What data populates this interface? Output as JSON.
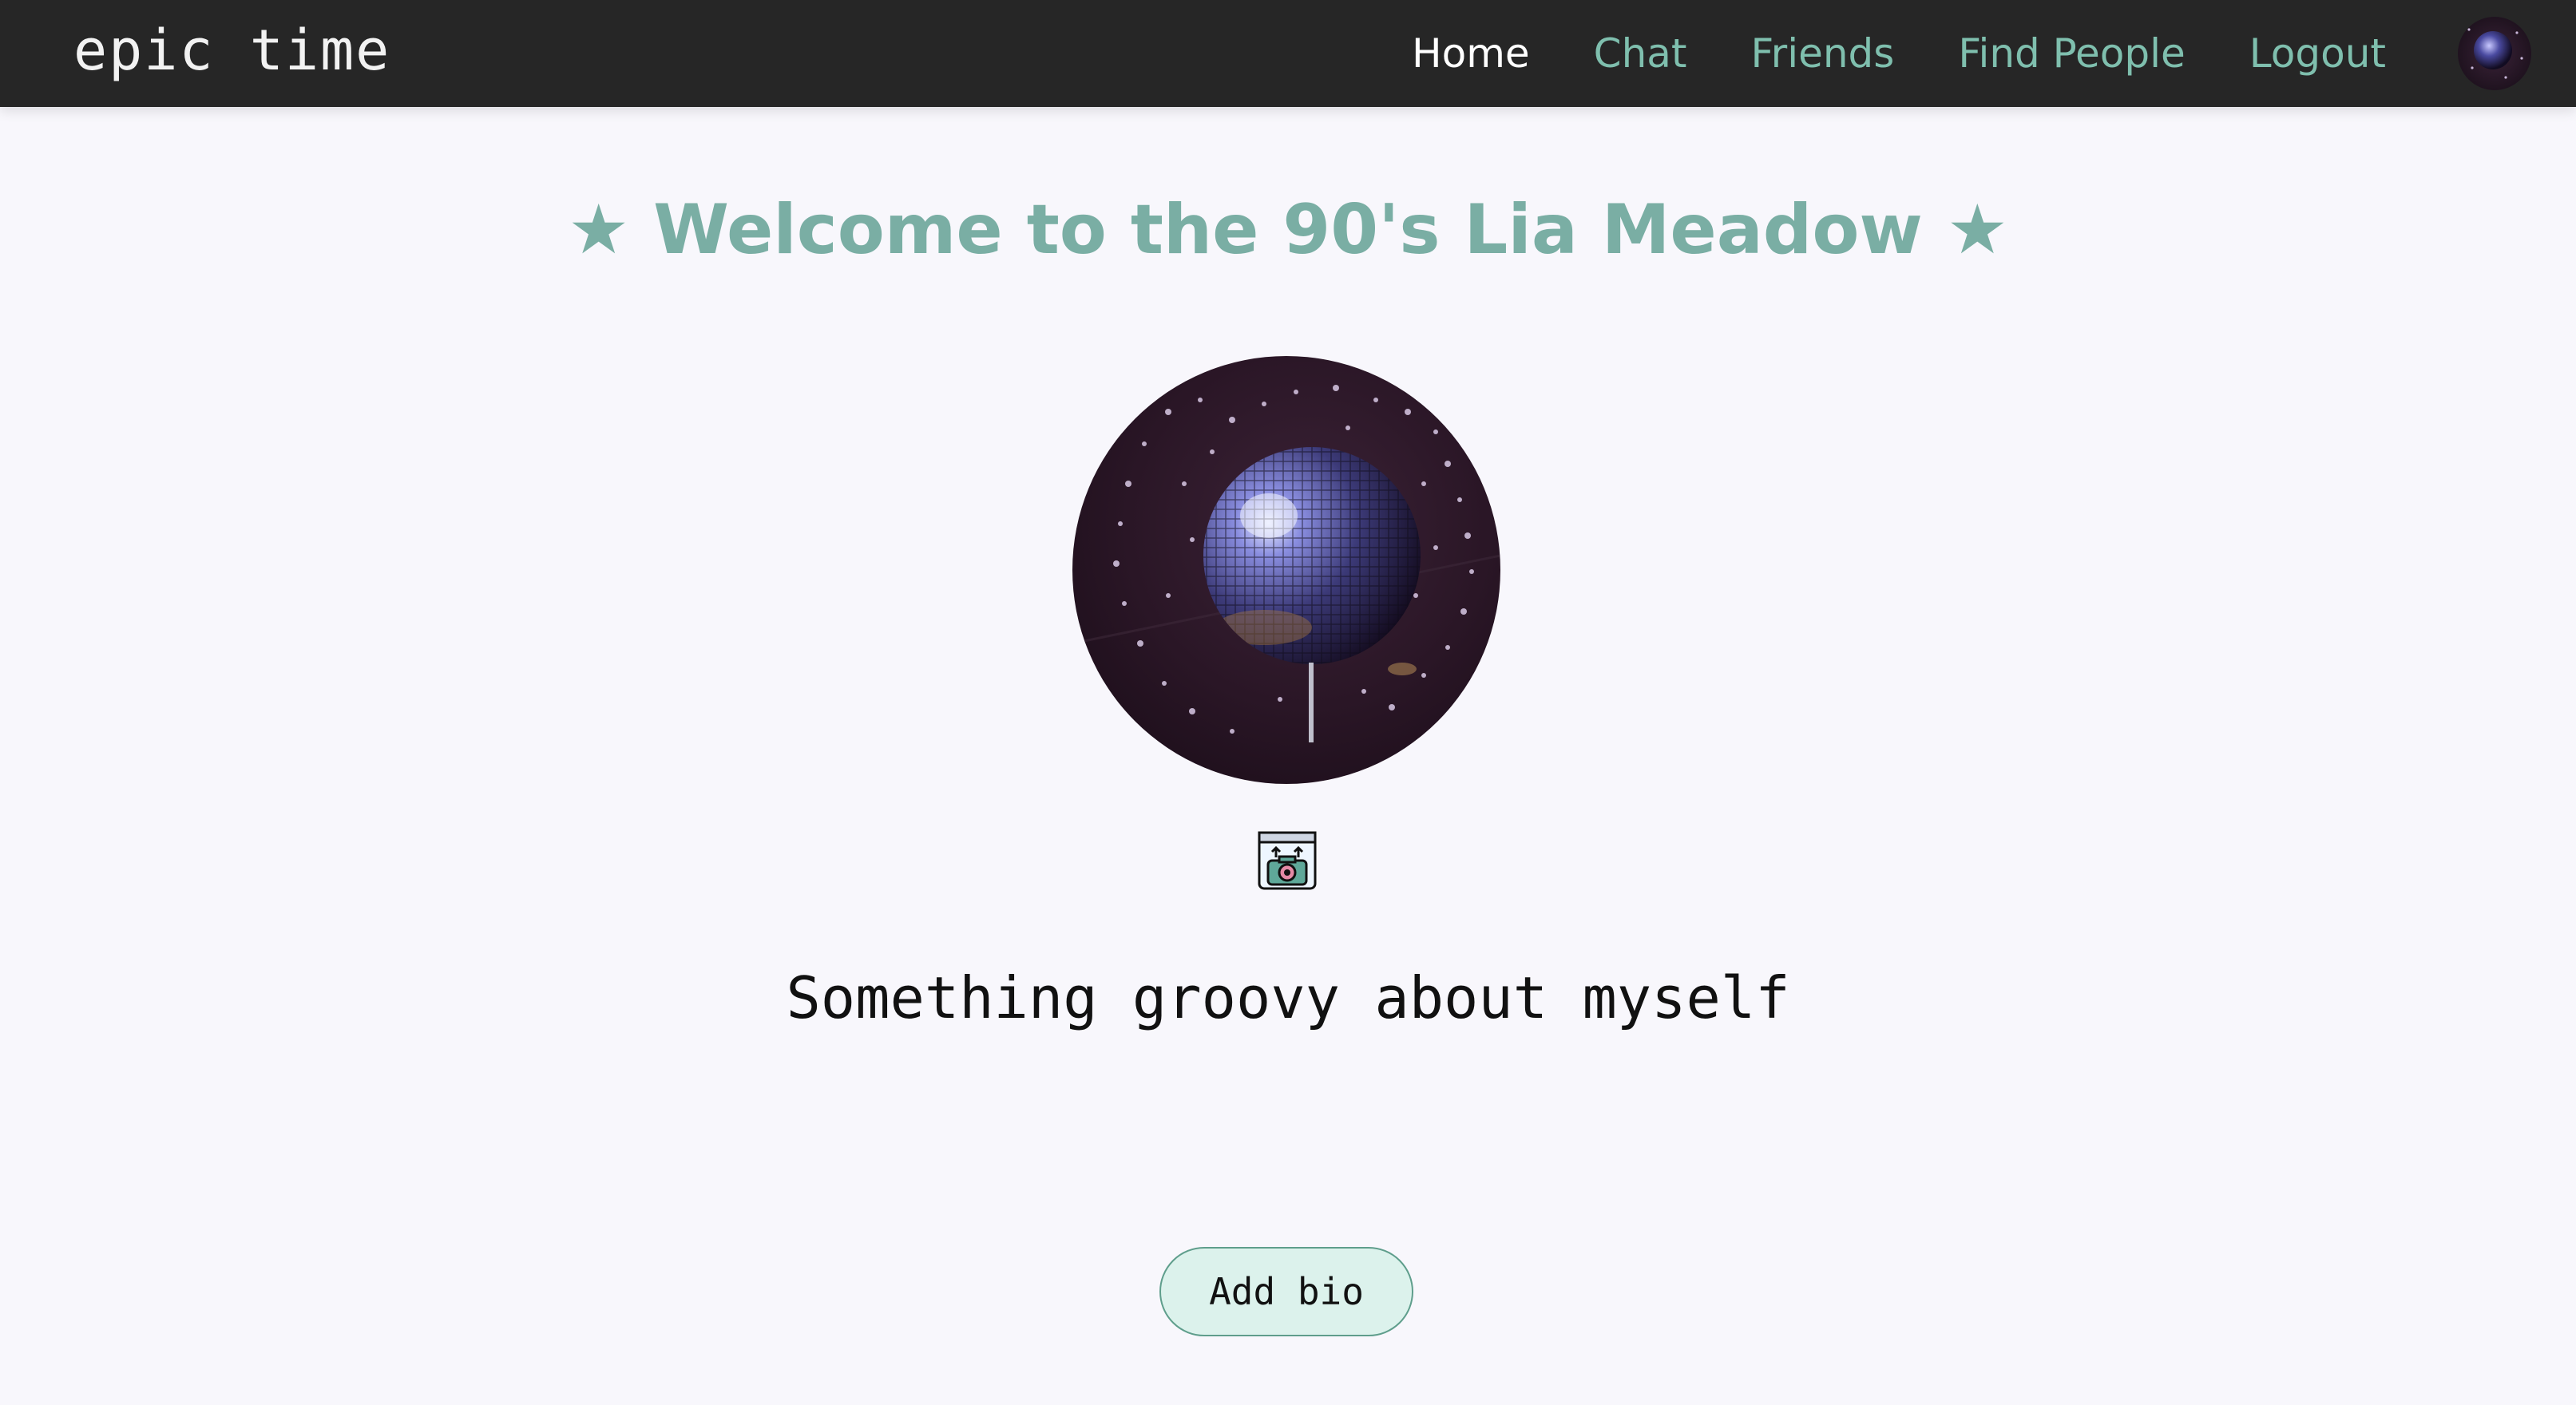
{
  "header": {
    "logo_text": "epic time",
    "nav": [
      {
        "label": "Home",
        "active": true
      },
      {
        "label": "Chat",
        "active": false
      },
      {
        "label": "Friends",
        "active": false
      },
      {
        "label": "Find People",
        "active": false
      },
      {
        "label": "Logout",
        "active": false
      }
    ],
    "avatar_icon": "disco-ball-avatar"
  },
  "main": {
    "welcome_heading": "★ Welcome to the 90's Lia Meadow ★",
    "profile_image": "disco-ball-photo",
    "upload_icon": "camera-upload-icon",
    "bio_text": "Something groovy about myself",
    "add_bio_label": "Add bio"
  },
  "colors": {
    "header_bg": "#262626",
    "nav_link": "#7fbfae",
    "nav_active": "#ffffff",
    "heading": "#7aaea4",
    "page_bg": "#f8f7fc",
    "button_bg": "#dcf2ec",
    "button_border": "#5f9e8c"
  }
}
